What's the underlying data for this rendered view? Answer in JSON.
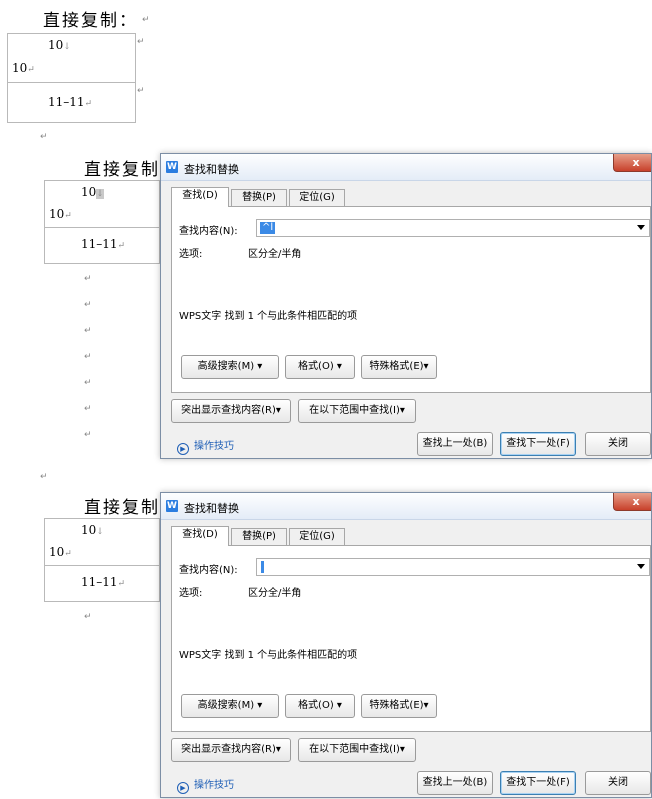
{
  "heading": "直接复制：",
  "para_mark": "↵",
  "line_break_mark": "↓",
  "table": {
    "cell1_line1": "10",
    "cell1_line2": "10",
    "cell2": "11–11"
  },
  "dialog": {
    "title": "查找和替换",
    "app_icon": "W",
    "close_glyph": "x",
    "tabs": [
      "查找(D)",
      "替换(P)",
      "定位(G)"
    ],
    "find_label": "查找内容(N):",
    "find_value_1": "^l",
    "find_value_2": "",
    "options_label": "选项:",
    "options_value": "区分全/半角",
    "result_message": "WPS文字 找到 1 个与此条件相匹配的项",
    "btn_advanced": "高级搜索(M) ▾",
    "btn_format": "格式(O) ▾",
    "btn_special": "特殊格式(E)▾",
    "btn_highlight": "突出显示查找内容(R)▾",
    "btn_find_in": "在以下范围中查找(I)▾",
    "tips": "操作技巧",
    "btn_prev": "查找上一处(B)",
    "btn_next": "查找下一处(F)",
    "btn_close": "关闭"
  },
  "icons": {
    "app": "wps-writer-icon",
    "close": "close-icon",
    "tips": "tips-play-icon",
    "dropdown": "chevron-down-icon"
  }
}
